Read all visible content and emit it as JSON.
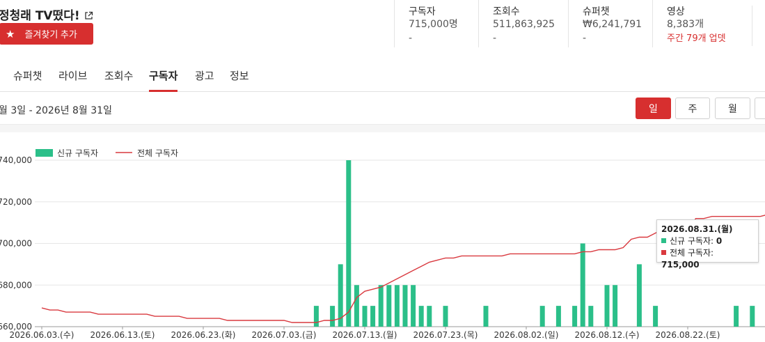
{
  "header": {
    "title": "정청래 TV떴다!",
    "favorite_label": "즐겨찾기 추가"
  },
  "stats": [
    {
      "label": "구독자",
      "value": "715,000명",
      "sub": "-"
    },
    {
      "label": "조회수",
      "value": "511,863,925",
      "sub": "-"
    },
    {
      "label": "슈퍼챗",
      "value": "₩6,241,791",
      "sub": "-"
    },
    {
      "label": "영상",
      "value": "8,383개",
      "sub": "주간 79개 업뎃"
    }
  ],
  "tabs": [
    {
      "label": "슈퍼챗",
      "active": false
    },
    {
      "label": "라이브",
      "active": false
    },
    {
      "label": "조회수",
      "active": false
    },
    {
      "label": "구독자",
      "active": true
    },
    {
      "label": "광고",
      "active": false
    },
    {
      "label": "정보",
      "active": false
    }
  ],
  "date_range": "월 3일 - 2026년 8월 31일",
  "period_buttons": [
    {
      "label": "일",
      "active": true
    },
    {
      "label": "주",
      "active": false
    },
    {
      "label": "월",
      "active": false
    }
  ],
  "colors": {
    "accent": "#d72f2f",
    "bar": "#2bbf89",
    "line": "#d9393f"
  },
  "chart_data": {
    "type": "bar",
    "legend": [
      "신규 구독자",
      "전체 구독자"
    ],
    "ylim": [
      660000,
      740000
    ],
    "y_ticks": [
      "660,000",
      "680,000",
      "700,000",
      "720,000",
      "740,000"
    ],
    "x_ticks": [
      "2026.06.03.(수)",
      "2026.06.13.(토)",
      "2026.06.23.(화)",
      "2026.07.03.(금)",
      "2026.07.13.(월)",
      "2026.07.23.(목)",
      "2026.08.02.(일)",
      "2026.08.12.(수)",
      "2026.08.22.(토)"
    ],
    "series": [
      {
        "name": "신규 구독자",
        "values": [
          0,
          0,
          0,
          0,
          0,
          0,
          0,
          0,
          0,
          0,
          0,
          0,
          0,
          0,
          0,
          0,
          0,
          0,
          0,
          0,
          0,
          0,
          0,
          0,
          0,
          0,
          0,
          0,
          0,
          0,
          0,
          0,
          0,
          0,
          1000,
          0,
          1000,
          3000,
          8000,
          2000,
          1000,
          1000,
          2000,
          2000,
          2000,
          2000,
          2000,
          1000,
          1000,
          0,
          1000,
          0,
          0,
          0,
          0,
          1000,
          0,
          0,
          0,
          0,
          0,
          0,
          1000,
          0,
          1000,
          0,
          1000,
          4000,
          1000,
          0,
          2000,
          2000,
          0,
          0,
          3000,
          0,
          1000,
          0,
          0,
          0,
          0,
          0,
          0,
          0,
          0,
          0,
          1000,
          0,
          1000,
          0
        ]
      },
      {
        "name": "전체 구독자",
        "values": [
          669000,
          668000,
          668000,
          667000,
          667000,
          667000,
          667000,
          666000,
          666000,
          666000,
          666000,
          666000,
          666000,
          666000,
          665000,
          665000,
          665000,
          665000,
          664000,
          664000,
          664000,
          664000,
          664000,
          663000,
          663000,
          663000,
          663000,
          663000,
          663000,
          663000,
          663000,
          662000,
          662000,
          662000,
          662000,
          663000,
          663000,
          664000,
          667000,
          674000,
          677000,
          678000,
          679000,
          681000,
          683000,
          685000,
          687000,
          689000,
          691000,
          692000,
          693000,
          693000,
          694000,
          694000,
          694000,
          694000,
          694000,
          694000,
          695000,
          695000,
          695000,
          695000,
          695000,
          695000,
          695000,
          695000,
          695000,
          696000,
          696000,
          697000,
          697000,
          697000,
          698000,
          702000,
          703000,
          703000,
          705000,
          707000,
          707000,
          707000,
          707000,
          712000,
          712000,
          713000,
          713000,
          713000,
          713000,
          713000,
          713000,
          713000,
          714000,
          714000,
          715000
        ]
      }
    ]
  },
  "tooltip": {
    "date": "2026.08.31.(월)",
    "new_label": "신규 구독자:",
    "new_value": "0",
    "total_label": "전체 구독자:",
    "total_value": "715,000"
  }
}
